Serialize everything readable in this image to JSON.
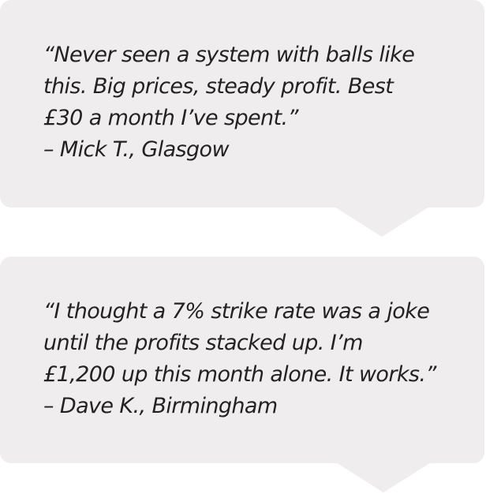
{
  "testimonials": [
    {
      "lines": [
        "“Never seen a system with balls like",
        "this. Big prices, steady profit. Best",
        "£30 a month I’ve spent.”"
      ],
      "attribution": "– Mick T., Glasgow"
    },
    {
      "lines": [
        "“I thought a 7% strike rate was a joke",
        "until the profits stacked up. I’m",
        "£1,200 up this month alone. It works.”"
      ],
      "attribution": "– Dave K., Birmingham"
    }
  ],
  "colors": {
    "bubble_background": "#efedee",
    "text": "#222222"
  }
}
